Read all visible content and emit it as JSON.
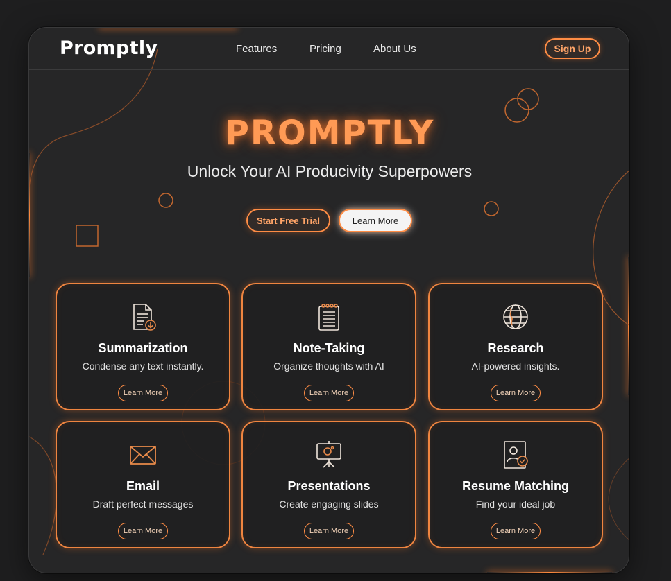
{
  "colors": {
    "accent": "#ff8d45",
    "background": "#262627",
    "page": "#1e1e1f"
  },
  "nav": {
    "logo": "Promptly",
    "links": [
      "Features",
      "Pricing",
      "About Us"
    ],
    "signup_label": "Sign Up"
  },
  "hero": {
    "title": "PROMPTLY",
    "subtitle": "Unlock Your AI Producivity Superpowers",
    "primary_cta": "Start Free Trial",
    "secondary_cta": "Learn More"
  },
  "cards": [
    {
      "title": "Summarization",
      "desc": "Condense any text instantly.",
      "button": "Learn More",
      "icon": "document-download-icon"
    },
    {
      "title": "Note-Taking",
      "desc": "Organize thoughts with AI",
      "button": "Learn More",
      "icon": "notepad-icon"
    },
    {
      "title": "Research",
      "desc": "AI-powered insights.",
      "button": "Learn More",
      "icon": "globe-icon"
    },
    {
      "title": "Email",
      "desc": "Draft perfect messages",
      "button": "Learn More",
      "icon": "envelope-icon"
    },
    {
      "title": "Presentations",
      "desc": "Create engaging slides",
      "button": "Learn More",
      "icon": "presentation-icon"
    },
    {
      "title": "Resume Matching",
      "desc": "Find your ideal job",
      "button": "Learn More",
      "icon": "resume-check-icon"
    }
  ]
}
